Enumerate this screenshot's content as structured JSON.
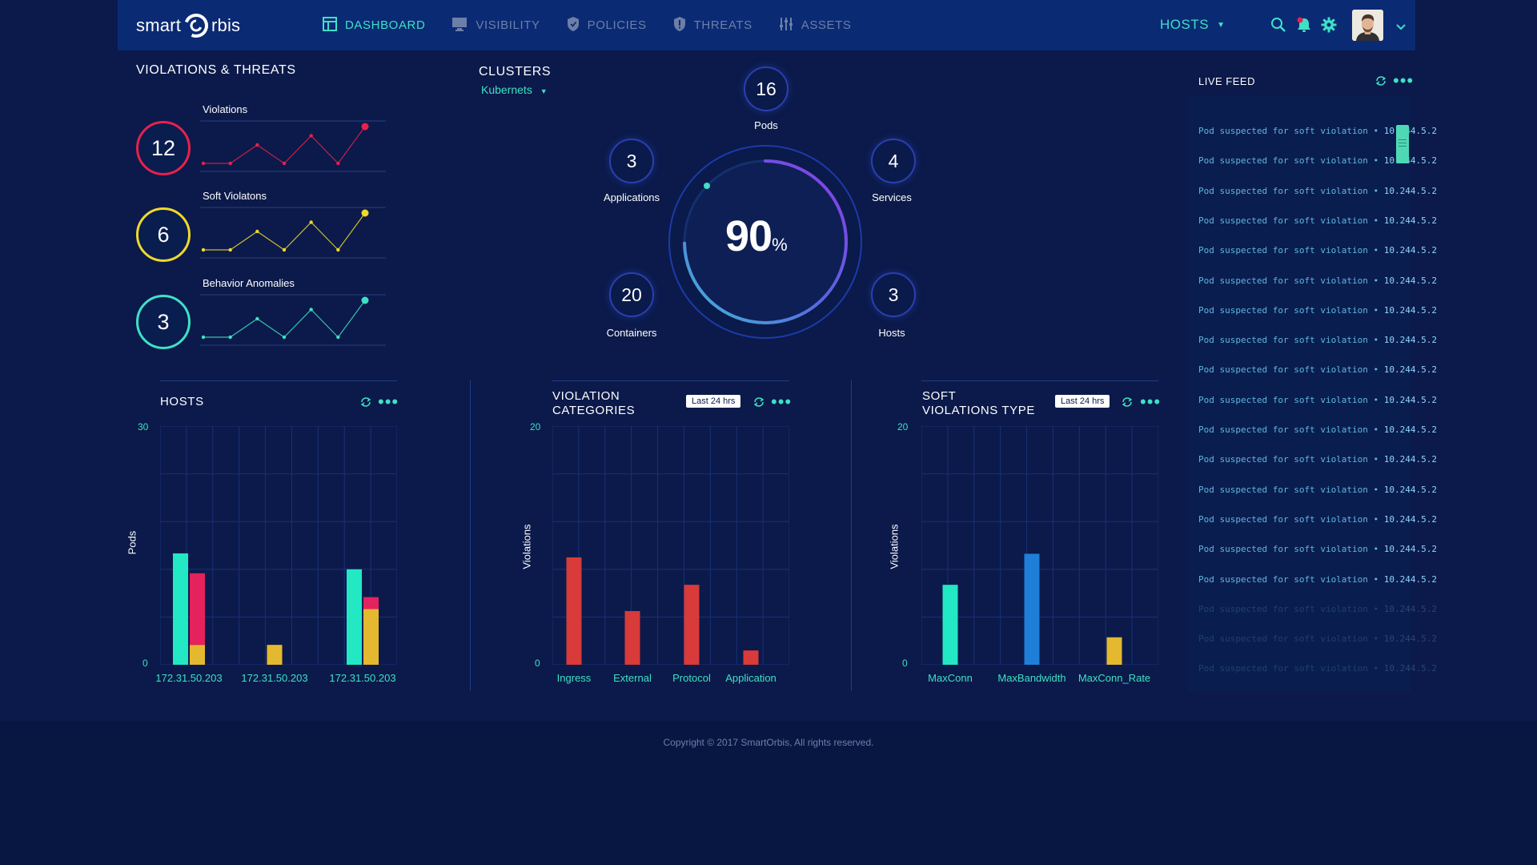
{
  "app": {
    "logo_left": "smart",
    "logo_right": "rbis"
  },
  "nav": [
    {
      "label": "DASHBOARD",
      "active": true
    },
    {
      "label": "VISIBILITY",
      "active": false
    },
    {
      "label": "POLICIES",
      "active": false
    },
    {
      "label": "THREATS",
      "active": false
    },
    {
      "label": "ASSETS",
      "active": false
    }
  ],
  "header": {
    "hosts_label": "HOSTS"
  },
  "violations": {
    "title": "VIOLATIONS & THREATS",
    "items": [
      {
        "label": "Violations",
        "count": "12",
        "color": "#e8204c",
        "trend": [
          1,
          1,
          3,
          1,
          4,
          1,
          5
        ]
      },
      {
        "label": "Soft Violatons",
        "count": "6",
        "color": "#f0d92a",
        "trend": [
          1,
          1,
          3,
          1,
          4,
          1,
          5
        ]
      },
      {
        "label": "Behavior Anomalies",
        "count": "3",
        "color": "#3fe0c5",
        "trend": [
          1,
          1,
          3,
          1,
          4,
          1,
          5
        ]
      }
    ]
  },
  "clusters": {
    "title": "CLUSTERS",
    "selected": "Kubernets",
    "percent": "90",
    "percent_unit": "%",
    "pods": {
      "value": "16",
      "label": "Pods"
    },
    "applications": {
      "value": "3",
      "label": "Applications"
    },
    "services": {
      "value": "4",
      "label": "Services"
    },
    "containers": {
      "value": "20",
      "label": "Containers"
    },
    "hosts": {
      "value": "3",
      "label": "Hosts"
    }
  },
  "live_feed": {
    "title": "LIVE FEED",
    "rows": [
      {
        "text": "Pod suspected for soft violation",
        "ip": "10.244.5.2"
      },
      {
        "text": "Pod suspected for soft violation",
        "ip": "10.244.5.2"
      },
      {
        "text": "Pod suspected for soft violation",
        "ip": "10.244.5.2"
      },
      {
        "text": "Pod suspected for soft violation",
        "ip": "10.244.5.2"
      },
      {
        "text": "Pod suspected for soft violation",
        "ip": "10.244.5.2"
      },
      {
        "text": "Pod suspected for soft violation",
        "ip": "10.244.5.2"
      },
      {
        "text": "Pod suspected for soft violation",
        "ip": "10.244.5.2"
      },
      {
        "text": "Pod suspected for soft violation",
        "ip": "10.244.5.2"
      },
      {
        "text": "Pod suspected for soft violation",
        "ip": "10.244.5.2"
      },
      {
        "text": "Pod suspected for soft violation",
        "ip": "10.244.5.2"
      },
      {
        "text": "Pod suspected for soft violation",
        "ip": "10.244.5.2"
      },
      {
        "text": "Pod suspected for soft violation",
        "ip": "10.244.5.2"
      },
      {
        "text": "Pod suspected for soft violation",
        "ip": "10.244.5.2"
      },
      {
        "text": "Pod suspected for soft violation",
        "ip": "10.244.5.2"
      },
      {
        "text": "Pod suspected for soft violation",
        "ip": "10.244.5.2"
      },
      {
        "text": "Pod suspected for soft violation",
        "ip": "10.244.5.2"
      },
      {
        "text": "Pod suspected for soft violation",
        "ip": "10.244.5.2"
      },
      {
        "text": "Pod suspected for soft violation",
        "ip": "10.244.5.2"
      },
      {
        "text": "Pod suspected for soft violation",
        "ip": "10.244.5.2"
      }
    ]
  },
  "hosts_chart": {
    "title": "HOSTS"
  },
  "vc_chart": {
    "title_line1": "VIOLATION",
    "title_line2": "CATEGORIES",
    "badge": "Last 24 hrs"
  },
  "svt_chart": {
    "title_line1": "SOFT",
    "title_line2": "VIOLATIONS TYPE",
    "badge": "Last 24 hrs"
  },
  "chart_data": [
    {
      "type": "bar",
      "title": "HOSTS",
      "ylabel": "Pods",
      "ylim": [
        0,
        30
      ],
      "y_ticks": [
        "30",
        "0"
      ],
      "categories": [
        "172.31.50.203",
        "172.31.50.203",
        "172.31.50.203"
      ],
      "series": [
        {
          "values": [
            14,
            0,
            12
          ],
          "color": "#22e8c4"
        },
        {
          "values": [
            2.5,
            2.5,
            7
          ],
          "color": "#e5b92f"
        },
        {
          "values": [
            9,
            0,
            1.5
          ],
          "color": "#e5225d"
        }
      ]
    },
    {
      "type": "bar",
      "title": "VIOLATION CATEGORIES",
      "ylabel": "Violations",
      "ylim": [
        0,
        20
      ],
      "y_ticks": [
        "20",
        "0"
      ],
      "categories": [
        "Ingress",
        "External",
        "Protocol",
        "Application"
      ],
      "values": [
        9,
        4.5,
        6.7,
        1.2
      ],
      "color": "#d93a3a"
    },
    {
      "type": "bar",
      "title": "SOFT VIOLATIONS TYPE",
      "ylabel": "Violations",
      "ylim": [
        0,
        20
      ],
      "y_ticks": [
        "20",
        "0"
      ],
      "categories": [
        "MaxConn",
        "MaxBandwidth",
        "MaxConn_Rate"
      ],
      "values": [
        6.7,
        9.3,
        2.3
      ],
      "colors": [
        "#22e8c4",
        "#1f7fd8",
        "#e5b92f"
      ]
    }
  ],
  "footer": {
    "copyright": "Copyright © 2017 SmartOrbis, All rights reserved."
  },
  "icons": {
    "nav": [
      "dashboard-icon",
      "monitor-icon",
      "shield-icon",
      "shield-alert-icon",
      "sliders-icon"
    ],
    "header": [
      "search-icon",
      "bell-icon",
      "gear-icon",
      "avatar",
      "chevron-down-icon"
    ]
  }
}
